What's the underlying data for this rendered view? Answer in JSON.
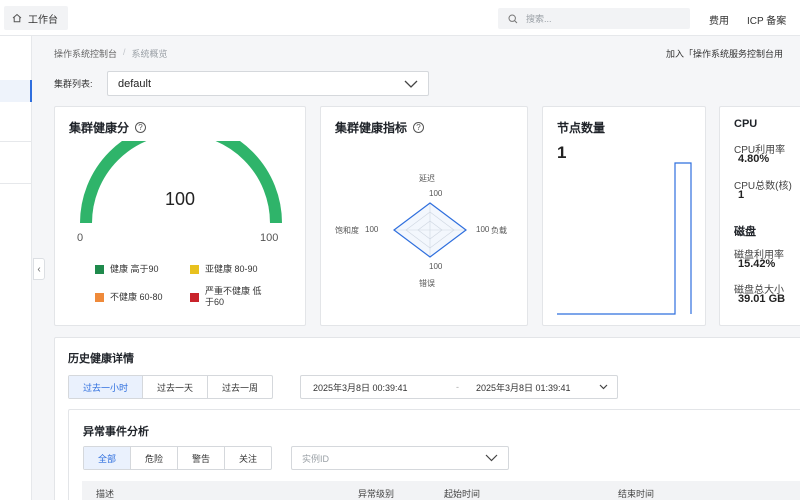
{
  "topbar": {
    "workbench_label": "工作台",
    "search_placeholder": "搜索...",
    "links": [
      "费用",
      "ICP 备案"
    ]
  },
  "breadcrumb": {
    "root": "操作系统控制台",
    "separator": "/",
    "current": "系统概览"
  },
  "join_link": "加入「操作系统服务控制台用",
  "cluster": {
    "label": "集群列表:",
    "selected": "default"
  },
  "health_score": {
    "title": "集群健康分",
    "value": "100",
    "gauge_fraction": 1.0,
    "min": "0",
    "max": "100",
    "legend": [
      {
        "label": "健康 高于90",
        "color": "#1f8a4c"
      },
      {
        "label": "亚健康 80-90",
        "color": "#e8c11e"
      },
      {
        "label": "不健康 60-80",
        "color": "#ef8a3a"
      },
      {
        "label": "严重不健康 低于60",
        "color": "#c9232b"
      }
    ],
    "gauge_color": "#2fb46a"
  },
  "health_metrics": {
    "title": "集群健康指标",
    "axes": [
      {
        "name": "延迟",
        "value": "100"
      },
      {
        "name": "负载",
        "value": "100"
      },
      {
        "name": "错误",
        "value": "100"
      },
      {
        "name": "饱和度",
        "value": "100"
      }
    ],
    "color": "#2f6fde"
  },
  "nodes": {
    "title": "节点数量",
    "count": "1"
  },
  "resources": {
    "cpu_title": "CPU",
    "cpu_usage_label": "CPU利用率",
    "cpu_usage_value": "4.80%",
    "cpu_count_label": "CPU总数(核)",
    "cpu_count_value": "1",
    "disk_title": "磁盘",
    "disk_usage_label": "磁盘利用率",
    "disk_usage_value": "15.42%",
    "disk_total_label": "磁盘总大小",
    "disk_total_value": "39.01 GB"
  },
  "history": {
    "title": "历史健康详情",
    "ranges": [
      "过去一小时",
      "过去一天",
      "过去一周"
    ],
    "active_range": 0,
    "start": "2025年3月8日 00:39:41",
    "dash": "-",
    "end": "2025年3月8日 01:39:41"
  },
  "anomaly": {
    "title": "异常事件分析",
    "filters": [
      "全部",
      "危险",
      "警告",
      "关注"
    ],
    "active_filter": 0,
    "instance_placeholder": "实例ID",
    "columns": [
      "描述",
      "异常级别",
      "起始时间",
      "结束时间"
    ]
  }
}
